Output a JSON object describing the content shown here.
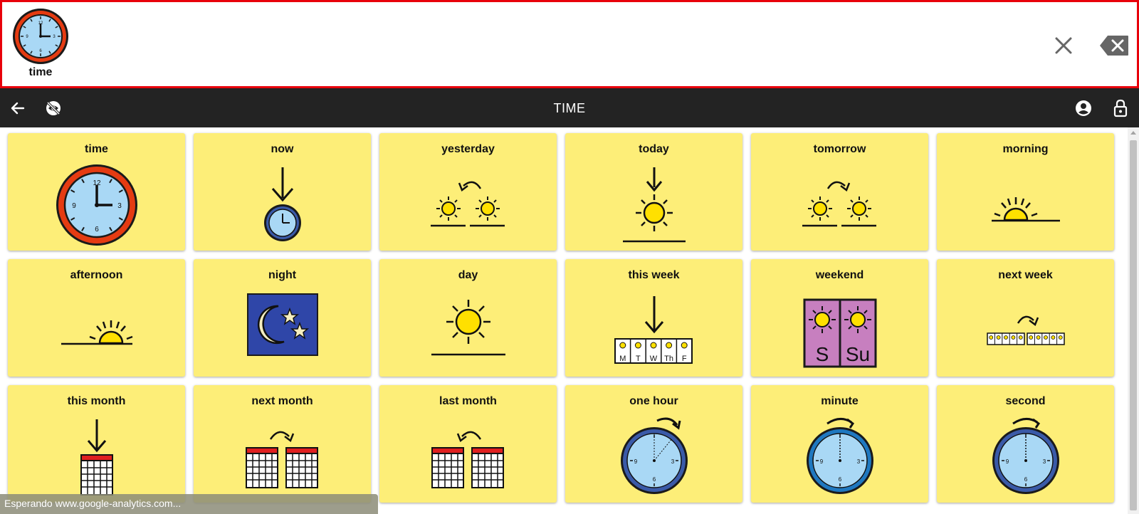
{
  "output": {
    "symbol_label": "time",
    "symbol_icon": "clock-icon"
  },
  "toolbar": {
    "title": "TIME",
    "back_icon": "arrow-left-icon",
    "hide_icon": "eye-off-icon",
    "account_icon": "account-circle-icon",
    "lock_icon": "lock-icon"
  },
  "grid": {
    "tiles": [
      {
        "label": "time",
        "icon": "clock-icon"
      },
      {
        "label": "now",
        "icon": "now-icon"
      },
      {
        "label": "yesterday",
        "icon": "yesterday-icon"
      },
      {
        "label": "today",
        "icon": "today-icon"
      },
      {
        "label": "tomorrow",
        "icon": "tomorrow-icon"
      },
      {
        "label": "morning",
        "icon": "morning-icon"
      },
      {
        "label": "afternoon",
        "icon": "afternoon-icon"
      },
      {
        "label": "night",
        "icon": "night-icon"
      },
      {
        "label": "day",
        "icon": "day-icon"
      },
      {
        "label": "this week",
        "icon": "this-week-icon"
      },
      {
        "label": "weekend",
        "icon": "weekend-icon"
      },
      {
        "label": "next week",
        "icon": "next-week-icon"
      },
      {
        "label": "this month",
        "icon": "this-month-icon"
      },
      {
        "label": "next month",
        "icon": "next-month-icon"
      },
      {
        "label": "last month",
        "icon": "last-month-icon"
      },
      {
        "label": "one hour",
        "icon": "one-hour-icon"
      },
      {
        "label": "minute",
        "icon": "minute-icon"
      },
      {
        "label": "second",
        "icon": "second-icon"
      }
    ]
  },
  "week": {
    "days": [
      "M",
      "T",
      "W",
      "Th",
      "F"
    ],
    "weekend_days": [
      "S",
      "Su"
    ]
  },
  "clock": {
    "numbers": [
      "12",
      "3",
      "6",
      "9"
    ]
  },
  "status": {
    "text": "Esperando www.google-analytics.com..."
  },
  "colors": {
    "tile": "#fdee78",
    "output_border": "#e8000b",
    "toolbar": "#232323",
    "sun": "#ffe000",
    "night": "#2f46a8",
    "weekend": "#c77fbf"
  }
}
